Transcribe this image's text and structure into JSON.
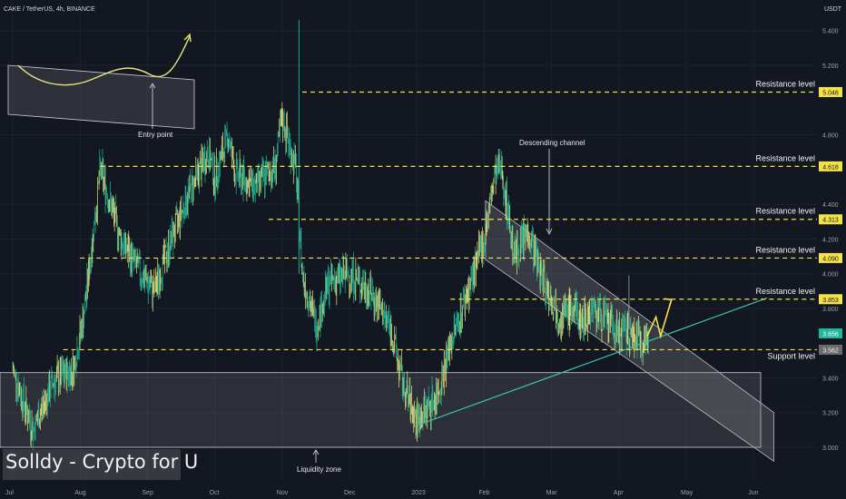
{
  "header": {
    "symbol_line": "CAKE / TetherUS, 4h, BINANCE",
    "currency": "USDT"
  },
  "watermark": "Solldy - Crypto for U",
  "colors": {
    "background": "#131722",
    "candle": "#1fb89a",
    "wick_light": "#e8e27a",
    "level_line": "#f3e24a",
    "trendline": "#3ec0a8",
    "zone_fill": "#6e6e74",
    "channel_fill": "#8a8a90",
    "arrow": "#f3e24a",
    "text": "#d1d4dc"
  },
  "chart_data": {
    "type": "candlestick",
    "x_axis_months": [
      "Jul",
      "Aug",
      "Sep",
      "Oct",
      "Nov",
      "Dec",
      "2023",
      "Feb",
      "Mar",
      "Apr",
      "May",
      "Jun"
    ],
    "y_ticks": [
      "5.400",
      "5.200",
      "4.800",
      "4.400",
      "4.200",
      "4.000",
      "3.800",
      "3.400",
      "3.200",
      "3.000"
    ],
    "ylim": [
      2.88,
      5.5
    ],
    "price_path": [
      [
        0,
        3.45
      ],
      [
        0.3,
        3.1
      ],
      [
        0.6,
        3.38
      ],
      [
        0.9,
        3.45
      ],
      [
        1.05,
        3.75
      ],
      [
        1.15,
        4.08
      ],
      [
        1.3,
        4.6
      ],
      [
        1.6,
        4.2
      ],
      [
        1.9,
        4.0
      ],
      [
        2.1,
        3.9
      ],
      [
        2.4,
        4.25
      ],
      [
        2.6,
        4.45
      ],
      [
        2.9,
        4.7
      ],
      [
        3.0,
        4.55
      ],
      [
        3.2,
        4.8
      ],
      [
        3.3,
        4.58
      ],
      [
        3.6,
        4.5
      ],
      [
        3.9,
        4.62
      ],
      [
        4.0,
        4.9
      ],
      [
        4.2,
        4.6
      ],
      [
        4.3,
        4.0
      ],
      [
        4.5,
        3.7
      ],
      [
        4.7,
        3.95
      ],
      [
        5.0,
        4.0
      ],
      [
        5.3,
        3.9
      ],
      [
        5.6,
        3.7
      ],
      [
        5.8,
        3.35
      ],
      [
        6.0,
        3.15
      ],
      [
        6.3,
        3.3
      ],
      [
        6.5,
        3.6
      ],
      [
        6.8,
        3.95
      ],
      [
        7.0,
        4.2
      ],
      [
        7.15,
        4.55
      ],
      [
        7.25,
        4.62
      ],
      [
        7.45,
        4.1
      ],
      [
        7.65,
        4.25
      ],
      [
        7.8,
        4.05
      ],
      [
        8.0,
        3.85
      ],
      [
        8.15,
        3.75
      ],
      [
        8.3,
        3.8
      ],
      [
        8.45,
        3.72
      ],
      [
        8.6,
        3.8
      ],
      [
        8.8,
        3.73
      ],
      [
        9.0,
        3.66
      ],
      [
        9.2,
        3.65
      ],
      [
        9.35,
        3.62
      ],
      [
        9.45,
        3.63
      ]
    ],
    "levels": [
      {
        "label": "Resistance level",
        "price": "5.046",
        "value": 5.046
      },
      {
        "label": "Resistance level",
        "price": "4.618",
        "value": 4.618
      },
      {
        "label": "Resistance level",
        "price": "4.313",
        "value": 4.313
      },
      {
        "label": "Resistance level",
        "price": "4.090",
        "value": 4.09
      },
      {
        "label": "Resistance level",
        "price": "3.853",
        "value": 3.853
      },
      {
        "label": "Support level",
        "price": "3.562",
        "value": 3.562
      }
    ],
    "current_price": {
      "price": "3.656",
      "value": 3.656
    },
    "annotations": {
      "entry_point": "Entry point",
      "descending_channel": "Descending channel",
      "liquidity_zone": "Liquidity zone"
    }
  }
}
